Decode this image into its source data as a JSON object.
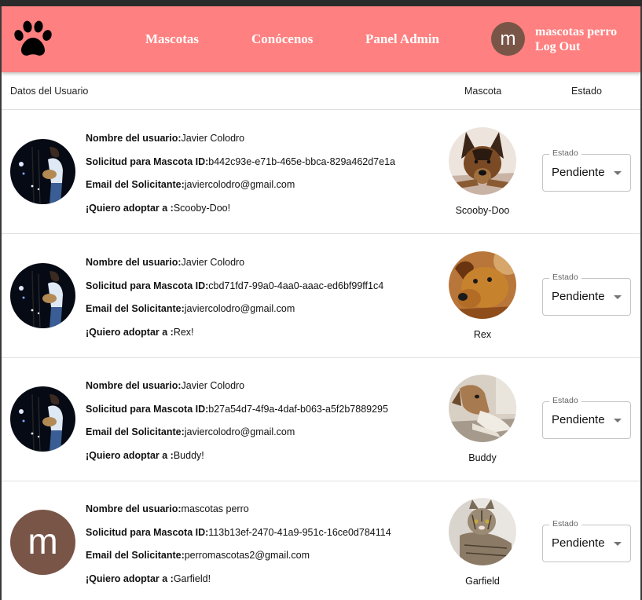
{
  "header": {
    "nav": [
      "Mascotas",
      "Conócenos",
      "Panel Admin"
    ],
    "avatar_letter": "m",
    "user_name": "mascotas perro",
    "logout": "Log Out"
  },
  "table": {
    "columns": [
      "Datos del Usuario",
      "Mascota",
      "Estado"
    ],
    "labels": {
      "user": "Nombre del usuario:",
      "request": "Solicitud para Mascota ID:",
      "email": "Email del Solicitante:",
      "adopt": "¡Quiero adoptar a :"
    },
    "select_label": "Estado",
    "rows": [
      {
        "user": "Javier Colodro",
        "pet_id": "b442c93e-e71b-465e-bbca-829a462d7e1a",
        "email": "javiercolodro@gmail.com",
        "adopt": "Scooby-Doo!",
        "pet_name": "Scooby-Doo",
        "status": "Pendiente"
      },
      {
        "user": "Javier Colodro",
        "pet_id": "cbd71fd7-99a0-4aa0-aaac-ed6bf99ff1c4",
        "email": "javiercolodro@gmail.com",
        "adopt": "Rex!",
        "pet_name": "Rex",
        "status": "Pendiente"
      },
      {
        "user": "Javier Colodro",
        "pet_id": "b27a54d7-4f9a-4daf-b063-a5f2b7889295",
        "email": "javiercolodro@gmail.com",
        "adopt": "Buddy!",
        "pet_name": "Buddy",
        "status": "Pendiente"
      },
      {
        "user": "mascotas perro",
        "pet_id": "113b13ef-2470-41a9-951c-16ce0d784114",
        "email": "perromascotas2@gmail.com",
        "adopt": "Garfield!",
        "pet_name": "Garfield",
        "status": "Pendiente",
        "avatar_letter": "m"
      }
    ]
  },
  "colors": {
    "header_bg": "#ff8080",
    "avatar_bg": "#795548"
  },
  "icons": {
    "logo": "paw-icon",
    "select_arrow": "arrow-drop-down-icon"
  }
}
